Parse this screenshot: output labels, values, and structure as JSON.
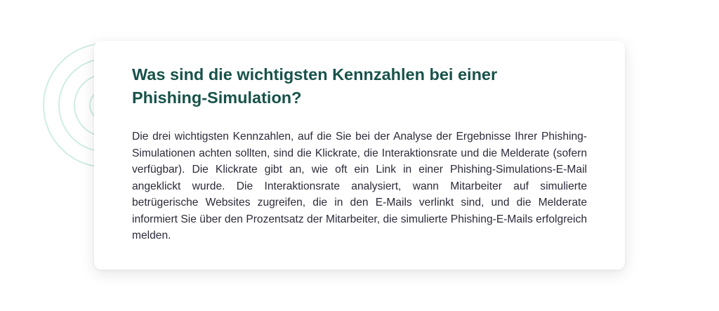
{
  "faq": {
    "question": "Was sind die wichtigsten Kennzahlen bei einer Phishing-Simulation?",
    "answer": "Die drei wichtigsten Kennzahlen, auf die Sie bei der Analyse der Ergebnisse Ihrer Phishing-Simulationen achten sollten, sind die Klickrate, die Interaktionsrate und die Melderate (sofern verfügbar). Die Klickrate gibt an, wie oft ein Link in einer Phishing-Simulations-E-Mail angeklickt wurde. Die Interaktionsrate analysiert, wann Mitarbeiter auf simulierte betrügerische Websites zugreifen, die in den E-Mails verlinkt sind, und die Melderate informiert Sie über den Prozentsatz der Mitarbeiter, die simulierte Phishing-E-Mails erfolgreich melden."
  },
  "colors": {
    "heading": "#17524a",
    "body_text": "#2b2b3a",
    "ring_accent": "#bfe8d8",
    "background": "#ffffff"
  }
}
